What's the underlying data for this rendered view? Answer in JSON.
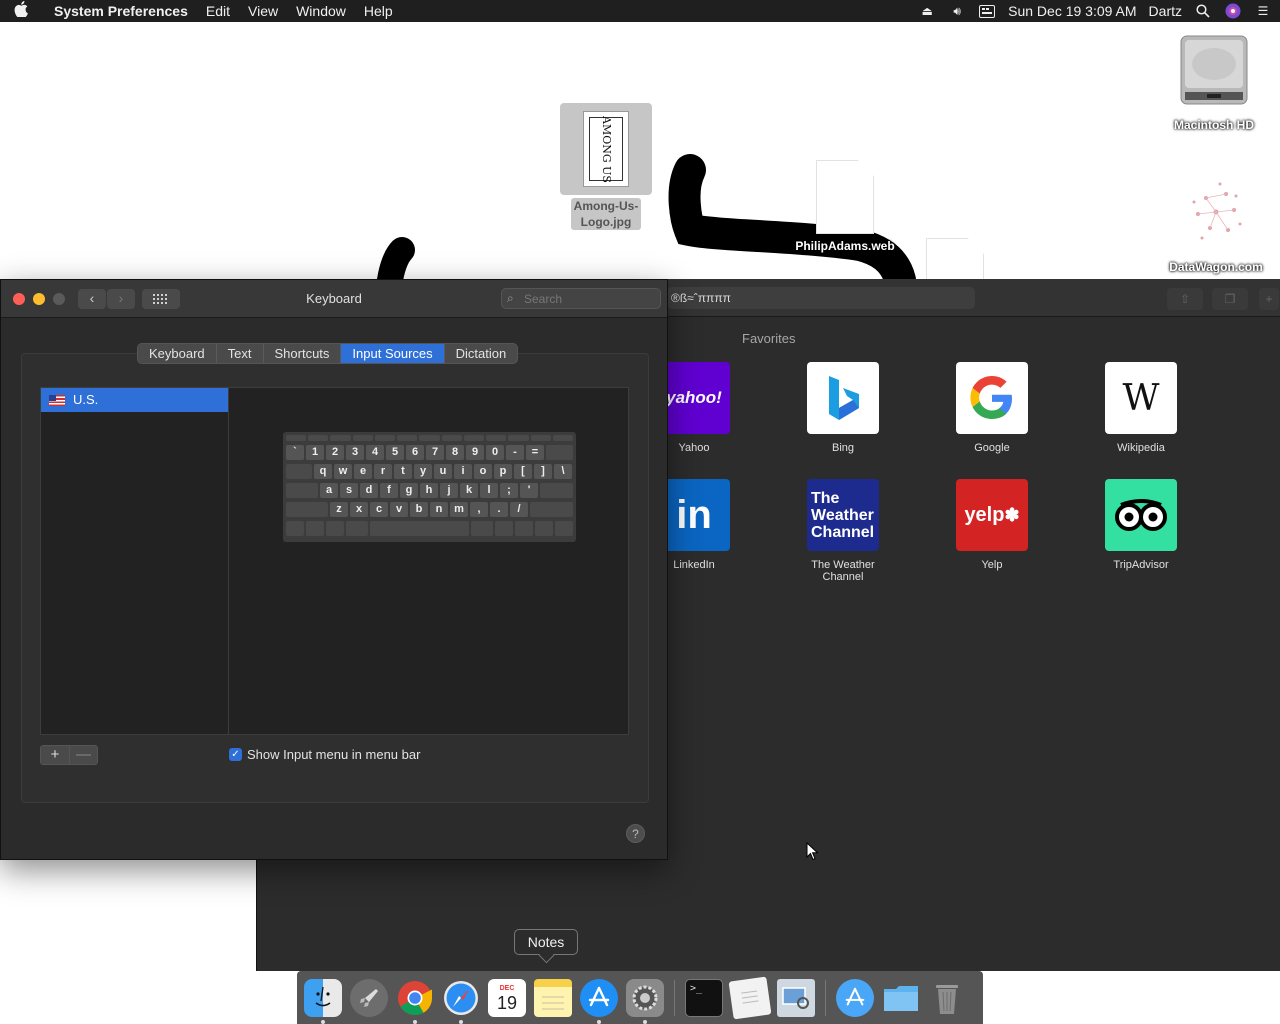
{
  "menubar": {
    "apple_icon": "apple-logo",
    "app_name": "System Preferences",
    "items": [
      "Edit",
      "View",
      "Window",
      "Help"
    ],
    "datetime": "Sun Dec 19  3:09 AM",
    "user": "Dartz"
  },
  "desktop": {
    "macintosh_hd": "Macintosh HD",
    "datawagon": "DataWagon.com",
    "among_us_line1": "Among-Us-",
    "among_us_line2": "Logo.jpg",
    "among_us_thumb_text": "AMONG US",
    "philip": "PhilipAdams.web"
  },
  "browser": {
    "address": "®ß≈ˆππππ",
    "favorites_title": "Favorites",
    "favorites": [
      {
        "label": "Yahoo",
        "logo": "yahoo!",
        "color": "#6001d2"
      },
      {
        "label": "Bing",
        "logo": "b",
        "color": "#ffffff"
      },
      {
        "label": "Google",
        "logo": "G",
        "color": "#ffffff"
      },
      {
        "label": "Wikipedia",
        "logo": "W",
        "color": "#ffffff"
      },
      {
        "label": "LinkedIn",
        "logo": "in",
        "color": "#0a66c2"
      },
      {
        "label": "The Weather Channel",
        "label_line1": "The Weather",
        "label_line2": "Channel",
        "logo_line1": "The",
        "logo_line2": "Weather",
        "logo_line3": "Channel",
        "color": "#1d2b8f"
      },
      {
        "label": "Yelp",
        "logo": "yelp",
        "color": "#d32323"
      },
      {
        "label": "TripAdvisor",
        "logo": "oo",
        "color": "#34e0a1"
      }
    ]
  },
  "prefs": {
    "title": "Keyboard",
    "search_placeholder": "Search",
    "tabs": [
      "Keyboard",
      "Text",
      "Shortcuts",
      "Input Sources",
      "Dictation"
    ],
    "active_tab": "Input Sources",
    "sources": [
      {
        "name": "U.S."
      }
    ],
    "add_label": "+",
    "remove_label": "—",
    "show_input_menu_label": "Show Input menu in menu bar",
    "show_input_menu_checked": true,
    "help_label": "?"
  },
  "keyboard_layout": {
    "row1": [
      "`",
      "1",
      "2",
      "3",
      "4",
      "5",
      "6",
      "7",
      "8",
      "9",
      "0",
      "-",
      "="
    ],
    "row2": [
      "q",
      "w",
      "e",
      "r",
      "t",
      "y",
      "u",
      "i",
      "o",
      "p",
      "[",
      "]",
      "\\"
    ],
    "row3": [
      "a",
      "s",
      "d",
      "f",
      "g",
      "h",
      "j",
      "k",
      "l",
      ";",
      "'"
    ],
    "row4": [
      "z",
      "x",
      "c",
      "v",
      "b",
      "n",
      "m",
      ",",
      ".",
      "/"
    ]
  },
  "dock": {
    "tooltip": "Notes",
    "calendar_month": "DEC",
    "calendar_day": "19",
    "items": [
      "Finder",
      "Launchpad",
      "Chrome",
      "Safari",
      "Calendar",
      "Notes",
      "App Store",
      "System Preferences",
      "Terminal",
      "TextEdit",
      "Preview",
      "Downloads",
      "Documents",
      "Trash"
    ]
  }
}
